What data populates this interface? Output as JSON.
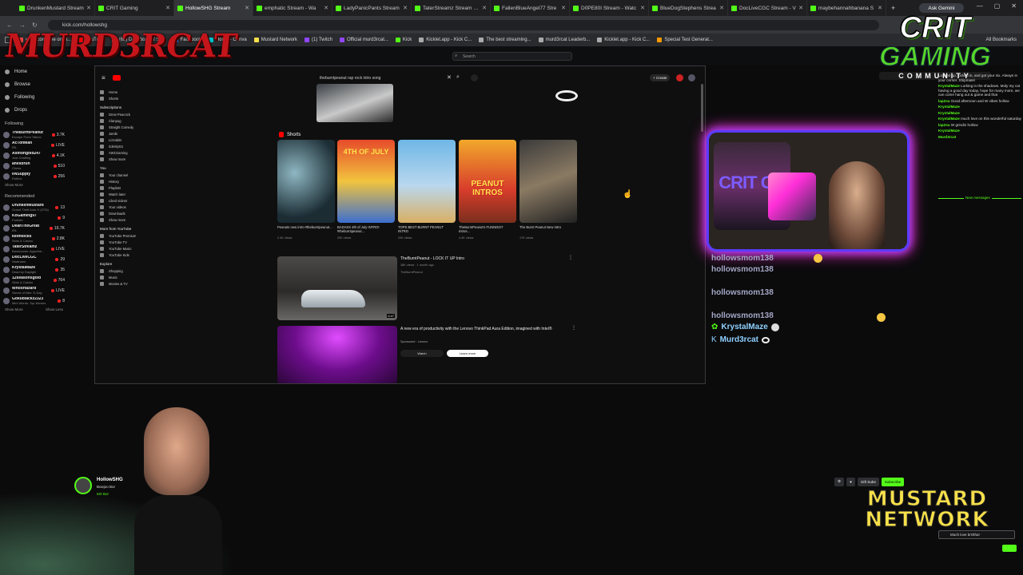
{
  "browser": {
    "tabs": [
      {
        "label": "DrunkenMustard Stream"
      },
      {
        "label": "CRIT Gaming"
      },
      {
        "label": "HollowSHG Stream",
        "active": true
      },
      {
        "label": "emphatic Stream - Wa"
      },
      {
        "label": "LadyPanicPants Stream"
      },
      {
        "label": "TaterStreamz Stream - V"
      },
      {
        "label": "FallenBlueAngel77 Stre"
      },
      {
        "label": "D0PE80I Stream - Watc"
      },
      {
        "label": "BlueDogStephens Strea"
      },
      {
        "label": "DocLiveCGC Stream - V"
      },
      {
        "label": "maybehannahbanana S"
      }
    ],
    "ask_gemini": "Ask Gemini",
    "url": "kick.com/hollowshg",
    "bookmarks": [
      "ezgif.com free onlin...",
      "YouTube",
      "(68) Dashboard / Str...",
      "Facebook",
      "Home - Canva",
      "Mustard Network",
      "(1) Twitch",
      "Official murd3rcat...",
      "Kick",
      "Kicklet.app - Kick C...",
      "The best streaming...",
      "murd3rcat Leaderb...",
      "Kicklet.app - Kick C...",
      "Special Test Generat..."
    ],
    "all_bookmarks": "All Bookmarks",
    "search_placeholder": "Search"
  },
  "overlay": {
    "murd3rcat_logo": "MURD3RCAT",
    "crit_logo_main": "CRIT",
    "crit_logo_sub": "GAMING",
    "crit_logo_tag": "COMMUNITY",
    "cam_label": "CRIT GC",
    "mustard_line1": "MUSTARD",
    "mustard_line2": "NETWORK"
  },
  "kick_sidebar": {
    "nav": [
      "Home",
      "Browse",
      "Following",
      "Drops"
    ],
    "following_label": "Following",
    "following": [
      {
        "name": "TheBurntPeanut",
        "game": "Escape From Tarkov",
        "viewers": "3.7K"
      },
      {
        "name": "AcTonMan",
        "game": "IRL",
        "viewers": "LIVE"
      },
      {
        "name": "Asmongold247",
        "game": "Just Chatting",
        "viewers": "4.1K"
      },
      {
        "name": "ahesbruh",
        "game": "Chess",
        "viewers": "510"
      },
      {
        "name": "eNSupply",
        "game": "Roblox",
        "viewers": "256"
      }
    ],
    "show_more": "Show More",
    "recommended_label": "Recommended",
    "recommended": [
      {
        "name": "DrunkenMustard",
        "game": "Grand Theft Auto V (GTA)",
        "viewers": "13"
      },
      {
        "name": "KoGaming97",
        "game": "Fortnite",
        "viewers": "9"
      },
      {
        "name": "DeanTheGreat",
        "game": "IRL",
        "viewers": "16.7K"
      },
      {
        "name": "keithlocks",
        "game": "Slots & Casino",
        "viewers": "2.8K"
      },
      {
        "name": "TaterStreamz",
        "game": "Backrooms: Apprehe...",
        "viewers": "LIVE"
      },
      {
        "name": "DocLiveCGC",
        "game": "Warframe",
        "viewers": "29"
      },
      {
        "name": "KrystalMaze",
        "game": "Dead by Daylight",
        "viewers": "35"
      },
      {
        "name": "12seasonsgold",
        "game": "Slots & Casino",
        "viewers": "764"
      },
      {
        "name": "WhosHazard",
        "game": "Sword of Nier: E-Day",
        "viewers": "LIVE"
      },
      {
        "name": "Gokublackz2323",
        "game": "Mini Words: Top Movies",
        "viewers": "8"
      }
    ],
    "show_more_2": "Show More",
    "show_less": "Show Less"
  },
  "youtube": {
    "search_query": "theburntpeanut rap rock intro song",
    "sidebar_top": [
      "Home",
      "Shorts"
    ],
    "subs_label": "Subscriptions",
    "subs": [
      "Drew Peacock",
      "Clanpug",
      "Straight Comedy",
      "Jambi",
      "Lizzabits",
      "ridertipGo",
      "AW1Gaming"
    ],
    "show_more": "Show more",
    "you_label": "You",
    "you_items": [
      "Your channel",
      "History",
      "Playlists",
      "Watch later",
      "Liked videos",
      "Your videos",
      "Downloads"
    ],
    "show_more_2": "Show more",
    "more_label": "More from YouTube",
    "more_items": [
      "YouTube Premium",
      "YouTube TV",
      "YouTube Music",
      "YouTube Kids"
    ],
    "explore_label": "Explore",
    "explore_items": [
      "Shopping",
      "Music",
      "Movies & TV"
    ],
    "shorts_label": "Shorts",
    "shorts": [
      {
        "title": "Peanuts new intro #theburntpeanut...",
        "views": "2.4K views"
      },
      {
        "title": "BADASS 4th of July INTRO! #theburntpeanut...",
        "views": "20K views"
      },
      {
        "title": "TOPS BEST BURNT PEANUT INTRO",
        "views": "20K views"
      },
      {
        "title": "TheBurntPeanut's FUNNIEST Intros...",
        "views": "4.4K views"
      },
      {
        "title": "The Burnt Peanut New Intro",
        "views": "17K views"
      }
    ],
    "thumb_texts": [
      "4TH OF JULY",
      "PEANUT INTROS"
    ],
    "video1_title": "TheBurntPeanut - LOCK IT UP Intro",
    "video1_meta": "38K views · 1 month ago",
    "video1_channel": "TheBurntPeanut",
    "video1_duration": "0:47",
    "ad_title": "A new era of productivity with the Lenovo ThinkPad Aura Edition, imagined with Intel®",
    "ad_sponsor": "Sponsored · Lenovo",
    "ad_watch": "Watch",
    "ad_learn": "Learn more",
    "create_label": "+ Create"
  },
  "overlay_chat": {
    "lines": [
      {
        "user": "hollowsmom138"
      },
      {
        "user": "hollowsmom138"
      },
      {
        "user": "hollowsmom138"
      },
      {
        "user": "hollowsmom138"
      },
      {
        "user": "KrystalMaze"
      },
      {
        "user": "Murd3rcat"
      }
    ]
  },
  "kick_chat": {
    "messages": [
      {
        "user": "",
        "text": "Loaded up, locked in, and got your six. Always in your corner. Shipmate!"
      },
      {
        "user": "KrystalMaze",
        "text": "Lurking in the shadows. Moly my cat having a good day today, hope for many more, we can come hang out & game and that"
      },
      {
        "user": "lap2su",
        "text": "Good afternoon and W vibes hollow"
      },
      {
        "user": "KrystalMaze",
        "text": ""
      },
      {
        "user": "KrystalMaze",
        "text": ""
      },
      {
        "user": "KrystalMaze",
        "text": "much love on this wonderful saturday"
      },
      {
        "user": "lap2su",
        "text": "W grindin hollow"
      },
      {
        "user": "KrystalMaze",
        "text": ""
      },
      {
        "user": "Murd3rcat",
        "text": ""
      }
    ],
    "new_messages": "New messages",
    "gift_subs": "Gift Subs",
    "subscribe": "Subscribe",
    "input_text": "Much love brOtha!"
  },
  "streamer": {
    "name": "HollowSHG",
    "title": "Bowjoo Bor",
    "tag": "MX Bor"
  },
  "colors": {
    "kick_green": "#53fc18",
    "neon_pink": "#ff2fd8",
    "neon_purple": "#a040ff",
    "crit_green": "#57d62a",
    "mustard": "#f7e04a"
  }
}
